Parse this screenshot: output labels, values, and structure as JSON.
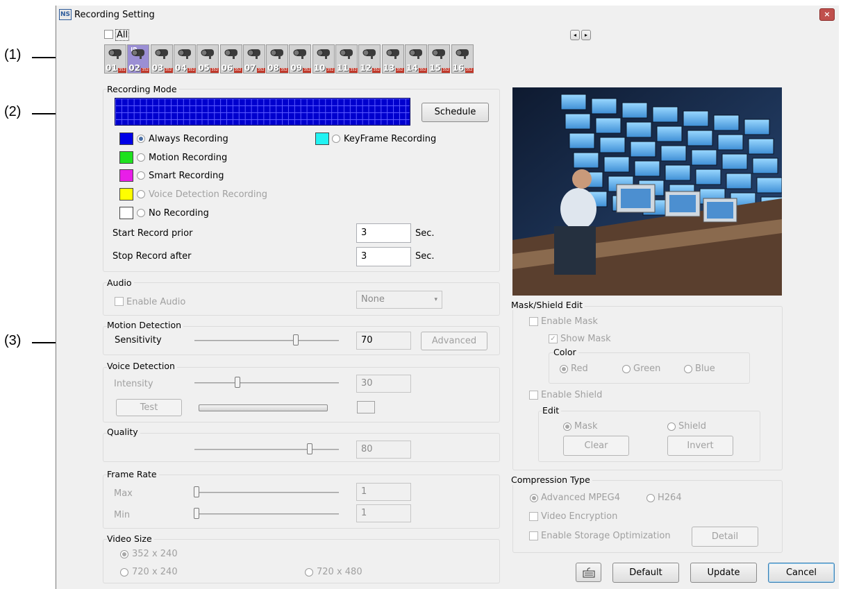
{
  "window": {
    "title": "Recording Setting",
    "close": "×"
  },
  "callouts": {
    "c1": "(1)",
    "c2": "(2)",
    "c3": "(3)"
  },
  "camera_bar": {
    "all_label": "All",
    "cameras": [
      "01",
      "02",
      "03",
      "04",
      "05",
      "06",
      "07",
      "08",
      "09",
      "10",
      "11",
      "12",
      "13",
      "14",
      "15",
      "16"
    ],
    "selected": "02",
    "ip_tag": "IP",
    "res_tag": "352",
    "prev": "◂",
    "next": "▸"
  },
  "recording_mode": {
    "title": "Recording Mode",
    "schedule_button": "Schedule",
    "options": {
      "always": "Always Recording",
      "keyframe": "KeyFrame Recording",
      "motion": "Motion Recording",
      "smart": "Smart Recording",
      "voice": "Voice Detection Recording",
      "none": "No Recording"
    },
    "colors": {
      "always": "#0000e6",
      "keyframe": "#22f2f2",
      "motion": "#1ee11e",
      "smart": "#e81ee8",
      "voice": "#ffff00",
      "none": "#ffffff"
    },
    "start_prior_label": "Start Record prior",
    "start_prior_value": "3",
    "stop_after_label": "Stop Record after",
    "stop_after_value": "3",
    "unit": "Sec."
  },
  "audio": {
    "title": "Audio",
    "enable_label": "Enable Audio",
    "source_value": "None"
  },
  "motion_detection": {
    "title": "Motion Detection",
    "sensitivity_label": "Sensitivity",
    "sensitivity_value": "70",
    "advanced_button": "Advanced",
    "level": 0.7
  },
  "voice_detection": {
    "title": "Voice Detection",
    "intensity_label": "Intensity",
    "intensity_value": "30",
    "test_button": "Test",
    "level": 0.3
  },
  "quality": {
    "title": "Quality",
    "value": "80",
    "level": 0.8
  },
  "frame_rate": {
    "title": "Frame Rate",
    "max_label": "Max",
    "max_value": "1",
    "min_label": "Min",
    "min_value": "1"
  },
  "video_size": {
    "title": "Video Size",
    "opt1": "352 x 240",
    "opt2": "720 x 240",
    "opt3": "720 x 480"
  },
  "mask_shield": {
    "title": "Mask/Shield Edit",
    "enable_mask": "Enable Mask",
    "show_mask": "Show Mask",
    "color_title": "Color",
    "red": "Red",
    "green": "Green",
    "blue": "Blue",
    "enable_shield": "Enable Shield",
    "edit_title": "Edit",
    "mask": "Mask",
    "shield": "Shield",
    "clear_button": "Clear",
    "invert_button": "Invert"
  },
  "compression": {
    "title": "Compression Type",
    "mpeg4": "Advanced MPEG4",
    "h264": "H264",
    "video_encryption": "Video Encryption",
    "storage_opt": "Enable Storage Optimization",
    "detail_button": "Detail"
  },
  "footer": {
    "default_button": "Default",
    "update_button": "Update",
    "cancel_button": "Cancel"
  }
}
